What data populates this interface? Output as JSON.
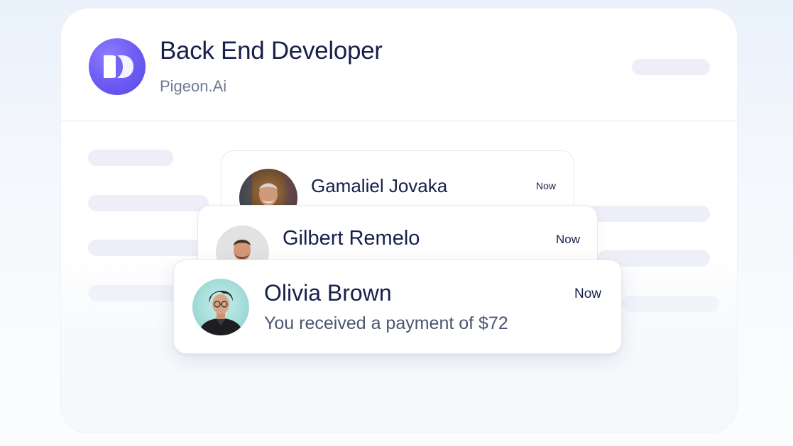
{
  "job": {
    "title": "Back End Developer",
    "company": "Pigeon.Ai",
    "logo_icon": "pigeon-ai-logo-icon",
    "accent": "#6c5af3"
  },
  "notifications": [
    {
      "name": "Gamaliel Jovaka",
      "time": "Now",
      "avatar_icon": "avatar-photo"
    },
    {
      "name": "Gilbert Remelo",
      "time": "Now",
      "avatar_icon": "avatar-photo"
    },
    {
      "name": "Olivia Brown",
      "time": "Now",
      "message": "You received a payment of $72",
      "avatar_icon": "avatar-photo"
    }
  ]
}
